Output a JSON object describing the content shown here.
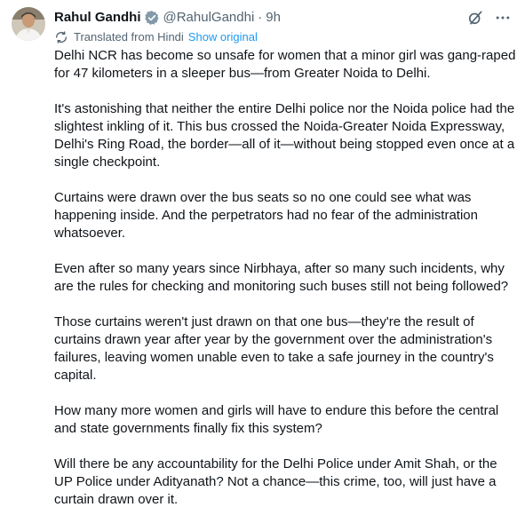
{
  "tweet": {
    "author_name": "Rahul Gandhi",
    "handle": "@RahulGandhi",
    "separator": "·",
    "time": "9h",
    "translated_label": "Translated from Hindi",
    "show_original": "Show original",
    "paragraphs": [
      "Delhi NCR has become so unsafe for women that a minor girl was gang-raped for 47 kilometers in a sleeper bus—from Greater Noida to Delhi.",
      "It's astonishing that neither the entire Delhi police nor the Noida police had the slightest inkling of it. This bus crossed the Noida-Greater Noida Expressway, Delhi's Ring Road, the border—all of it—without being stopped even once at a single checkpoint.",
      "Curtains were drawn over the bus seats so no one could see what was happening inside. And the perpetrators had no fear of the administration whatsoever.",
      "Even after so many years since Nirbhaya, after so many such incidents, why are the rules for checking and monitoring such buses still not being followed?",
      "Those curtains weren't just drawn on that one bus—they're the result of curtains drawn year after year by the government over the administration's failures, leaving women unable even to take a safe journey in the country's capital.",
      "How many more women and girls will have to endure this before the central and state governments finally fix this system?",
      "Will there be any accountability for the Delhi Police under Amit Shah, or the UP Police under Adityanath? Not a chance—this crime, too, will just have a curtain drawn over it."
    ]
  },
  "icons": {
    "verified": "verified-badge-icon",
    "grok": "grok-icon",
    "more": "more-icon",
    "translate": "translate-icon"
  },
  "colors": {
    "text": "#0f1419",
    "secondary": "#536471",
    "link": "#1d9bf0",
    "badge": "#829aab"
  }
}
